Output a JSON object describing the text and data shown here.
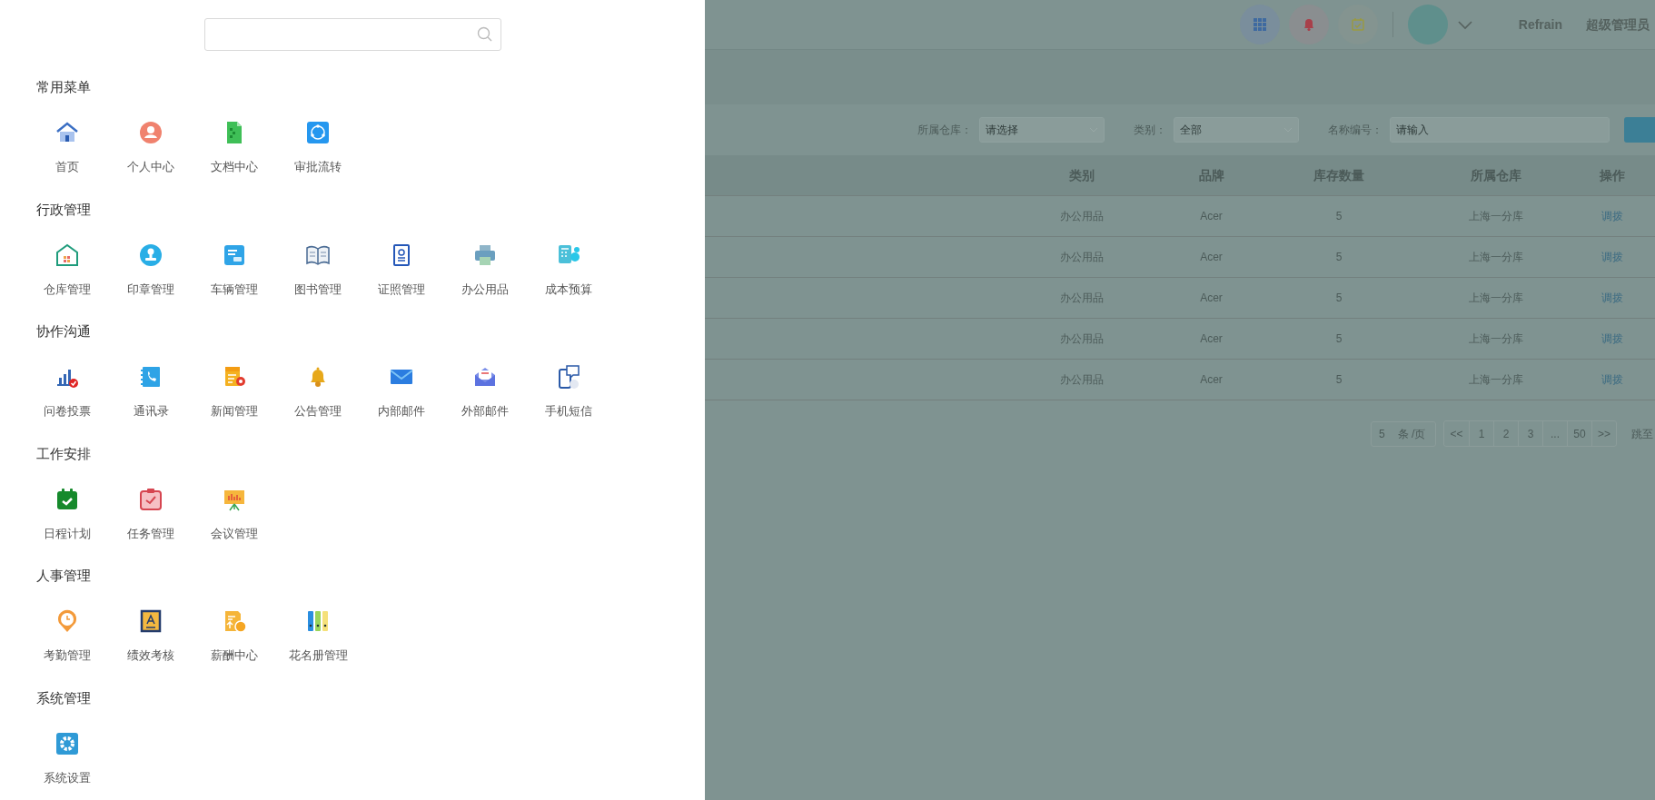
{
  "menu_sections": [
    {
      "title": "常用菜单",
      "items": [
        {
          "label": "首页"
        },
        {
          "label": "个人中心"
        },
        {
          "label": "文档中心"
        },
        {
          "label": "审批流转"
        }
      ]
    },
    {
      "title": "行政管理",
      "items": [
        {
          "label": "仓库管理"
        },
        {
          "label": "印章管理"
        },
        {
          "label": "车辆管理"
        },
        {
          "label": "图书管理"
        },
        {
          "label": "证照管理"
        },
        {
          "label": "办公用品"
        },
        {
          "label": "成本预算"
        }
      ]
    },
    {
      "title": "协作沟通",
      "items": [
        {
          "label": "问卷投票"
        },
        {
          "label": "通讯录"
        },
        {
          "label": "新闻管理"
        },
        {
          "label": "公告管理"
        },
        {
          "label": "内部邮件"
        },
        {
          "label": "外部邮件"
        },
        {
          "label": "手机短信"
        }
      ]
    },
    {
      "title": "工作安排",
      "items": [
        {
          "label": "日程计划"
        },
        {
          "label": "任务管理"
        },
        {
          "label": "会议管理"
        }
      ]
    },
    {
      "title": "人事管理",
      "items": [
        {
          "label": "考勤管理"
        },
        {
          "label": "绩效考核"
        },
        {
          "label": "薪酬中心"
        },
        {
          "label": "花名册管理"
        }
      ]
    },
    {
      "title": "系统管理",
      "items": [
        {
          "label": "系统设置"
        }
      ]
    }
  ],
  "header": {
    "user_name": "Refrain",
    "role": "超级管理员"
  },
  "filters": [
    {
      "kind": "select",
      "label": "所属仓库：",
      "placeholder": "请选择"
    },
    {
      "kind": "select",
      "label": "类别：",
      "placeholder": "全部"
    },
    {
      "kind": "input",
      "label": "名称编号：",
      "placeholder": "请输入"
    }
  ],
  "table": {
    "columns": [
      "类别",
      "品牌",
      "库存数量",
      "所属仓库",
      "操作"
    ],
    "rows": [
      [
        "办公用品",
        "Acer",
        "5",
        "上海一分库",
        "调拨"
      ],
      [
        "办公用品",
        "Acer",
        "5",
        "上海一分库",
        "调拨"
      ],
      [
        "办公用品",
        "Acer",
        "5",
        "上海一分库",
        "调拨"
      ],
      [
        "办公用品",
        "Acer",
        "5",
        "上海一分库",
        "调拨"
      ],
      [
        "办公用品",
        "Acer",
        "5",
        "上海一分库",
        "调拨"
      ]
    ]
  },
  "pagination": {
    "page_size": "5",
    "page_size_unit": "条 /页",
    "pages": [
      "<<",
      "1",
      "2",
      "3",
      "...",
      "50",
      ">>"
    ],
    "jump_label": "跳至"
  }
}
